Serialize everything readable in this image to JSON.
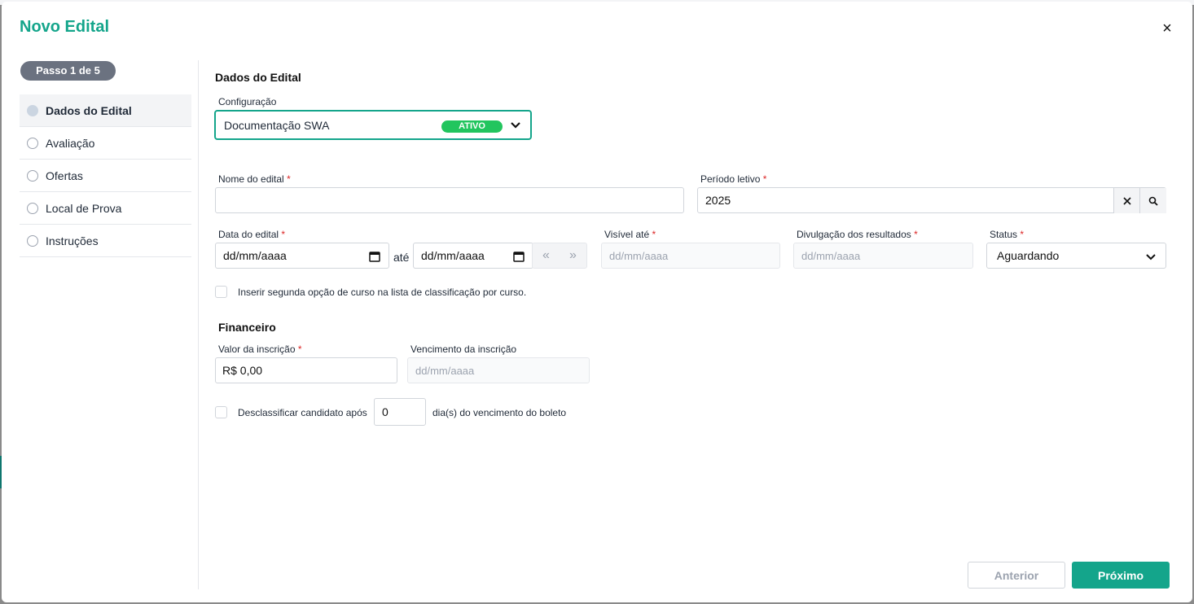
{
  "modal": {
    "title": "Novo Edital",
    "close_glyph": "×"
  },
  "stepper": {
    "badge": "Passo 1 de 5",
    "items": [
      {
        "label": "Dados do Edital",
        "active": true
      },
      {
        "label": "Avaliação",
        "active": false
      },
      {
        "label": "Ofertas",
        "active": false
      },
      {
        "label": "Local de Prova",
        "active": false
      },
      {
        "label": "Instruções",
        "active": false
      }
    ]
  },
  "dados": {
    "section_title": "Dados do Edital",
    "configuracao": {
      "label": "Configuração",
      "value": "Documentação SWA",
      "badge": "ATIVO"
    },
    "nome_edital": {
      "label": "Nome do edital",
      "required": "*",
      "value": ""
    },
    "periodo_letivo": {
      "label": "Período letivo",
      "required": "*",
      "value": "2025"
    },
    "data_edital": {
      "label": "Data do edital",
      "required": "*",
      "start_placeholder": "dd/mm/aaaa",
      "end_placeholder": "dd/mm/aaaa",
      "separator": "até"
    },
    "visivel_ate": {
      "label": "Visível até",
      "required": "*",
      "placeholder": "dd/mm/aaaa"
    },
    "divulgacao": {
      "label": "Divulgação dos resultados",
      "required": "*",
      "placeholder": "dd/mm/aaaa"
    },
    "status": {
      "label": "Status",
      "required": "*",
      "value": "Aguardando"
    },
    "segunda_opcao": {
      "label": "Inserir segunda opção de curso na lista de classificação por curso."
    }
  },
  "financeiro": {
    "section_title": "Financeiro",
    "valor": {
      "label": "Valor da inscrição",
      "required": "*",
      "value": "R$ 0,00"
    },
    "vencimento": {
      "label": "Vencimento da inscrição",
      "placeholder": "dd/mm/aaaa"
    },
    "desclassificar": {
      "label_before": "Desclassificar candidato após",
      "value": "0",
      "label_after": "dia(s) do vencimento do boleto"
    }
  },
  "footer": {
    "prev_label": "Anterior",
    "next_label": "Próximo"
  },
  "colors": {
    "brand": "#14a58b",
    "active_badge": "#22c55e",
    "step_badge": "#6b7280"
  }
}
